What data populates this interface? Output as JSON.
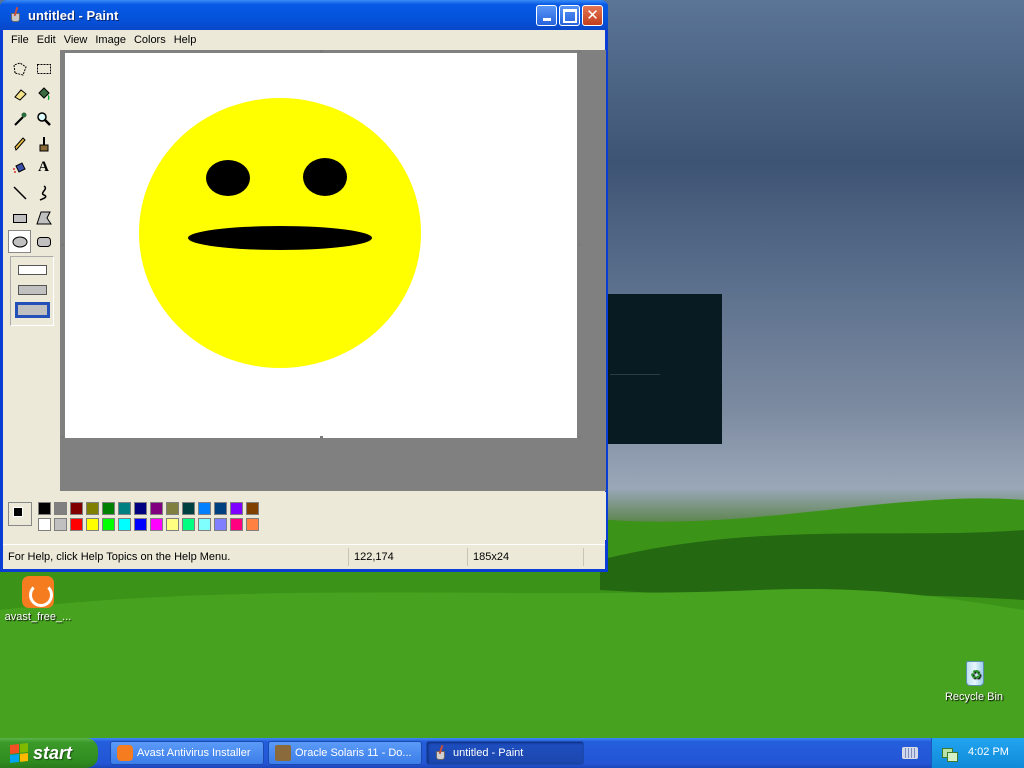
{
  "window": {
    "title": "untitled - Paint",
    "close_symbol": "✕"
  },
  "menu": [
    "File",
    "Edit",
    "View",
    "Image",
    "Colors",
    "Help"
  ],
  "tools": {
    "row_icons": [
      [
        "free-form-select-icon",
        "select-icon"
      ],
      [
        "eraser-icon",
        "fill-with-color-icon"
      ],
      [
        "pick-color-icon",
        "magnifier-icon"
      ],
      [
        "pencil-icon",
        "brush-icon"
      ],
      [
        "airbrush-icon",
        "text-icon"
      ],
      [
        "line-icon",
        "curve-icon"
      ],
      [
        "rectangle-icon",
        "polygon-icon"
      ],
      [
        "ellipse-icon",
        "rounded-rectangle-icon"
      ]
    ],
    "text_tool_glyph": "A",
    "selected": "ellipse-icon"
  },
  "palette": {
    "foreground": "#000000",
    "background": "#ffffff",
    "top_row": [
      "#000000",
      "#808080",
      "#800000",
      "#808000",
      "#008000",
      "#008080",
      "#000080",
      "#800080",
      "#808040",
      "#004040",
      "#0080ff",
      "#004080",
      "#8000ff",
      "#804000"
    ],
    "bottom_row": [
      "#ffffff",
      "#c0c0c0",
      "#ff0000",
      "#ffff00",
      "#00ff00",
      "#00ffff",
      "#0000ff",
      "#ff00ff",
      "#ffff80",
      "#00ff80",
      "#80ffff",
      "#8080ff",
      "#ff0080",
      "#ff8040"
    ]
  },
  "canvas_colors": {
    "face": "#ffff00",
    "features": "#000000"
  },
  "status": {
    "help_text": "For Help, click Help Topics on the Help Menu.",
    "cursor_pos": "122,174",
    "selection_size": "185x24"
  },
  "desktop": {
    "icons": [
      {
        "label": "avast_free_...",
        "icon": "avast-icon"
      },
      {
        "label": "Recycle Bin",
        "icon": "recycle-bin-icon"
      }
    ]
  },
  "taskbar": {
    "start_label": "start",
    "buttons": [
      {
        "label": "Avast Antivirus Installer",
        "icon": "avast-icon"
      },
      {
        "label": "Oracle Solaris 11 - Do...",
        "icon": "oracle-icon"
      },
      {
        "label": "untitled - Paint",
        "icon": "paint-icon"
      }
    ],
    "clock": "4:02 PM"
  }
}
